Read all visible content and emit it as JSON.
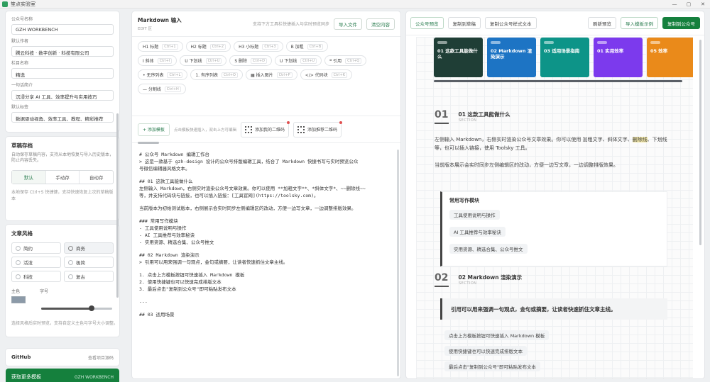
{
  "window": {
    "title": "笙点实验室",
    "controls": [
      "—",
      "▢",
      "✕"
    ]
  },
  "sidebar": {
    "fields": [
      {
        "label": "公众号名称",
        "value": "GZH WORKBENCH"
      },
      {
        "label": "默认作者",
        "value": "腾云科技 · 数字创新 · 科技有限公司"
      },
      {
        "label": "栏目名称",
        "value": "精选"
      },
      {
        "label": "一句话简介",
        "value": "沉浸分享 AI 工具、效率提升与实用技巧"
      },
      {
        "label": "默认标签",
        "value": "数据驱动视角、效率工具、教程、精彩推荐"
      }
    ],
    "draft": {
      "title": "草稿存档",
      "desc": "自动保存草稿内容，支持从本地恢复与导入历史版本，防止内容丢失。",
      "modes": [
        "默认",
        "手动存",
        "自动存"
      ],
      "active_mode": 0,
      "note": "本地保存 Ctrl+S 快捷键，支持快速恢复上次的草稿版本"
    },
    "style": {
      "title": "文章风格",
      "options": [
        {
          "label": "简约",
          "checked": false
        },
        {
          "label": "商务",
          "checked": true
        },
        {
          "label": "活泼",
          "checked": false
        },
        {
          "label": "极简",
          "checked": false
        },
        {
          "label": "科技",
          "checked": false
        },
        {
          "label": "复古",
          "checked": false
        }
      ],
      "color_label": "主色",
      "size_label": "字号",
      "size_value": 0.7,
      "note": "选择风格后实时预览，支持自定义主色与字号大小调整。"
    },
    "github": {
      "name": "GitHub",
      "link": "查看项目源码"
    },
    "more_button": {
      "label": "获取更多模板",
      "sub": "GZH WORKBENCH"
    }
  },
  "editor": {
    "title": "Markdown 输入",
    "subtitle": "EDIT 区",
    "hint": "支持下方工具栏快捷插入与实时预览同步",
    "import_label": "导入文件",
    "clear_label": "清空内容",
    "tools_rows": [
      [
        {
          "label": "H1 标题",
          "kb": "Ctrl+1"
        },
        {
          "label": "H2 标题",
          "kb": "Ctrl+2"
        },
        {
          "label": "H3 小标题",
          "kb": "Ctrl+3"
        },
        {
          "label": "B 加粗",
          "kb": "Ctrl+B"
        }
      ],
      [
        {
          "label": "I 斜体",
          "kb": "Ctrl+I"
        },
        {
          "label": "U 下划线",
          "kb": "Ctrl+U"
        },
        {
          "label": "S 删除",
          "kb": "Ctrl+D"
        },
        {
          "label": "U 下划线",
          "kb": "Ctrl+U"
        },
        {
          "label": "❝ 引用",
          "kb": "Ctrl+Q"
        }
      ],
      [
        {
          "label": "• 无序列表",
          "kb": "Ctrl+L"
        },
        {
          "label": "1. 有序列表",
          "kb": "Ctrl+O"
        },
        {
          "label": "▦ 插入图片",
          "kb": "Ctrl+P"
        },
        {
          "label": "</> 代码块",
          "kb": "Ctrl+K"
        }
      ],
      [
        {
          "label": "— 分割线",
          "kb": "Ctrl+H"
        }
      ]
    ],
    "add_template_label": "+ 添加模板",
    "template_hint": "点击模板快速插入，双击上方可编辑",
    "templates": [
      {
        "label": "添加我的二维码"
      },
      {
        "label": "添加推荐二维码"
      }
    ],
    "lines": [
      "# 公众号 Markdown 编辑工作台",
      "> 这是一款基于 gzh-design 设计的公众号排版编辑工具，结合了 Markdown 快捷书写与实时预览公众",
      "号微信编辑器风格文本。",
      "",
      "## 01 这款工具能做什么",
      "左侧输入 Markdown，右侧实时渲染公众号文章效果。你可以使用 **加粗文字**、*斜体文字*、~~删除线~~",
      "等，并支持代码块与链接，也可以插入链接：[工具官网](https://toolsky.com)。",
      "",
      "当前版本为初始测试版本，右侧展示会实时同步左侧编辑区的改动，方便一边写文章，一边调整排版效果。",
      "",
      "### 常用写作模块",
      "- 工具使用说明与操作",
      "- AI 工具推荐与效率秘诀",
      "- 实用资源、精选合集、公众号推文",
      "",
      "## 02 Markdown 渲染演示",
      "> 引用可以用来强调一句观点，金句或摘要，让读者快速抓住文章主线。",
      "",
      "1. 点击上方模板按钮可快速插入 Markdown 模板",
      "2. 使用快捷键也可以快速完成排版文本",
      "3. 最后点击\"复制到公众号\"即可粘贴发布文本",
      "",
      "---",
      "",
      "## 03 适用场景"
    ]
  },
  "preview": {
    "buttons": [
      {
        "label": "公众号预览",
        "style": "green-outline"
      },
      {
        "label": "复制到草稿",
        "style": "normal"
      },
      {
        "label": "复制公众号样式文本",
        "style": "normal"
      }
    ],
    "right_buttons": [
      {
        "label": "刷新预览",
        "style": "normal"
      },
      {
        "label": "导入模板示例",
        "style": "green-outline"
      },
      {
        "label": "复制到公众号",
        "style": "primary"
      }
    ],
    "cards": [
      {
        "title": "01 这款工具能做什么",
        "color": "#1f3e36"
      },
      {
        "title": "02 Markdown 渲染演示",
        "color": "#1d74c4"
      },
      {
        "title": "03 适用场景指南",
        "color": "#0d9488"
      },
      {
        "title": "01 实用效率",
        "color": "#7c3aed"
      },
      {
        "title": "05 效率",
        "color": "#ea8a1a"
      }
    ],
    "section1": {
      "num": "01",
      "title": "01 这款工具能做什么",
      "en": "SECTION"
    },
    "para1_pre": "左侧输入 Markdown，右侧实时渲染公众号文章效果。你可以使用 加粗文字、斜体文字、",
    "para1_hl": "删除线",
    "para1_post": "、下划线等，也可以插入链接，使用 Toolsky 工具。",
    "para2": "当前版本展示会实时同步左侧编辑区的改动，方便一边写文章，一边调整排版效果。",
    "box_title": "常用写作模块",
    "box_items": [
      "工具使用说明与操作",
      "AI 工具推荐与效率秘诀",
      "实用资源、精选合集、公众号推文"
    ],
    "section2": {
      "num": "02",
      "title": "02 Markdown 渲染演示",
      "en": "SECTION"
    },
    "quote": "引用可以用来强调一句观点，金句或摘要，让读者快速抓住文章主线。",
    "list_items": [
      "点击上方模板按钮可快速插入 Markdown 模板",
      "使用快捷键也可以快速完成排版文本",
      "最后点击\"复制到公众号\"即可粘贴发布文本"
    ]
  },
  "colors": {
    "primary": "#15803d",
    "accent_highlight": "#f3e8a8"
  }
}
